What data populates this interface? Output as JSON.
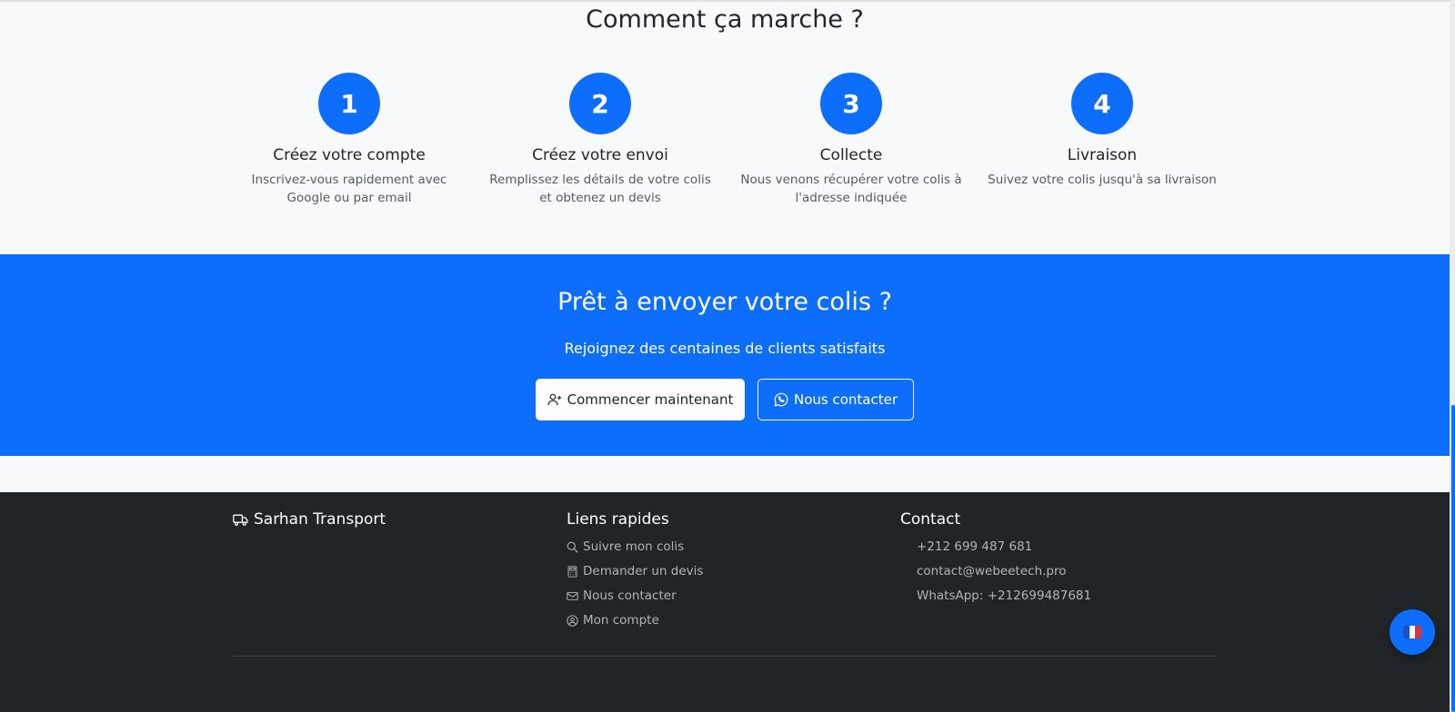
{
  "how_it_works": {
    "title": "Comment ça marche ?",
    "steps": [
      {
        "number": "1",
        "title": "Créez votre compte",
        "text": "Inscrivez-vous rapidement avec Google ou par email"
      },
      {
        "number": "2",
        "title": "Créez votre envoi",
        "text": "Remplissez les détails de votre colis et obtenez un devis"
      },
      {
        "number": "3",
        "title": "Collecte",
        "text": "Nous venons récupérer votre colis à l'adresse indiquée"
      },
      {
        "number": "4",
        "title": "Livraison",
        "text": "Suivez votre colis jusqu'à sa livraison"
      }
    ]
  },
  "cta": {
    "title": "Prêt à envoyer votre colis ?",
    "subtitle": "Rejoignez des centaines de clients satisfaits",
    "primary_button": {
      "label": "Commencer maintenant",
      "icon": "person-plus-icon"
    },
    "secondary_button": {
      "label": "Nous contacter",
      "icon": "whatsapp-icon"
    }
  },
  "footer": {
    "brand": {
      "name": "Sarhan Transport",
      "icon": "truck-icon"
    },
    "links": {
      "title": "Liens rapides",
      "items": [
        {
          "label": "Suivre mon colis",
          "icon": "search-icon"
        },
        {
          "label": "Demander un devis",
          "icon": "calculator-icon"
        },
        {
          "label": "Nous contacter",
          "icon": "envelope-icon"
        },
        {
          "label": "Mon compte",
          "icon": "person-circle-icon"
        }
      ]
    },
    "contact": {
      "title": "Contact",
      "phone": "+212 699 487 681",
      "email": "contact@webeetech.pro",
      "whatsapp": "WhatsApp: +212699487681"
    }
  },
  "language_switcher": {
    "flag": "france-flag-icon"
  },
  "colors": {
    "primary": "#0d6efd",
    "dark": "#212529",
    "light_bg": "#f8f9fa",
    "muted": "#adb5bd"
  }
}
